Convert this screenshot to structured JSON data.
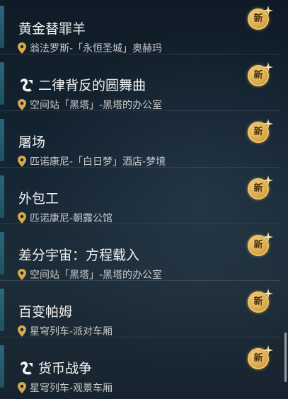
{
  "quests": [
    {
      "title": "黄金替罪羊",
      "location": "翁法罗斯-「永恒圣城」奥赫玛",
      "has_quest_icon": false,
      "badge": "新"
    },
    {
      "title": "二律背反的圆舞曲",
      "location": "空间站「黑塔」-黑塔的办公室",
      "has_quest_icon": true,
      "badge": "新"
    },
    {
      "title": "屠场",
      "location": "匹诺康尼-「白日梦」酒店-梦境",
      "has_quest_icon": false,
      "badge": "新"
    },
    {
      "title": "外包工",
      "location": "匹诺康尼-朝露公馆",
      "has_quest_icon": false,
      "badge": "新"
    },
    {
      "title": "差分宇宙：方程载入",
      "location": "空间站「黑塔」-黑塔的办公室",
      "has_quest_icon": false,
      "badge": "新"
    },
    {
      "title": "百变帕姆",
      "location": "星穹列车-派对车厢",
      "has_quest_icon": false,
      "badge": "新"
    },
    {
      "title": "货币战争",
      "location": "星穹列车-观景车厢",
      "has_quest_icon": true,
      "badge": "新"
    }
  ],
  "colors": {
    "badge_gold": "#d9a94b",
    "accent_teal": "#2c6f83",
    "title_text": "#f2f2f2",
    "location_text": "#c9c9c9"
  },
  "icons": {
    "location": "map-pin-icon",
    "quest": "quest-puzzle-icon",
    "badge": "new-badge-icon"
  }
}
